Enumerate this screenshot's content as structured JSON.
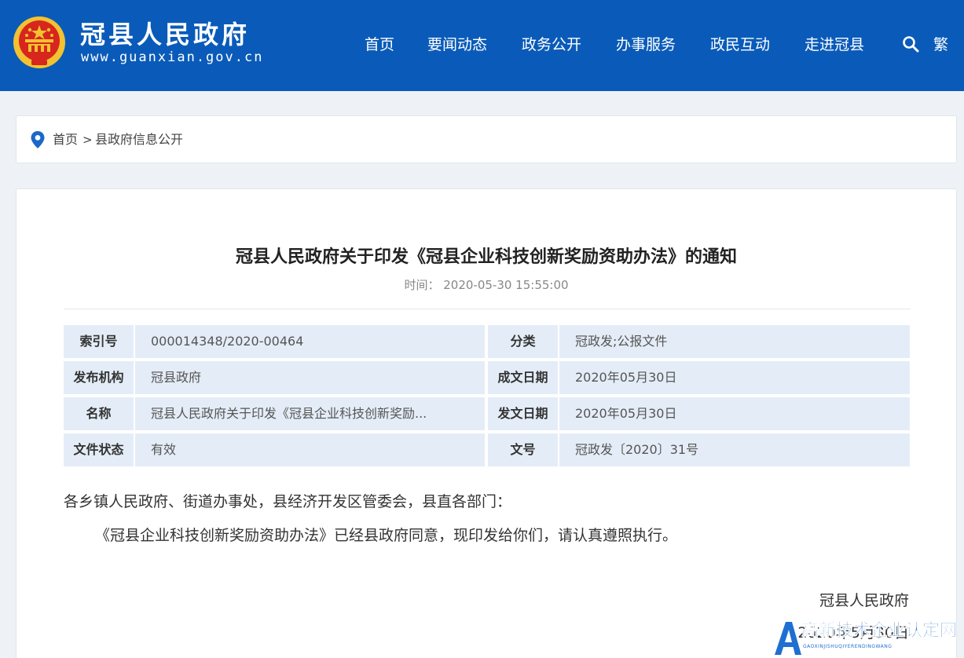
{
  "header": {
    "site_title": "冠县人民政府",
    "site_url": "www.guanxian.gov.cn",
    "nav": [
      "首页",
      "要闻动态",
      "政务公开",
      "办事服务",
      "政民互动",
      "走进冠县"
    ],
    "traditional_label": "繁",
    "search_icon": "search-icon",
    "brand_color": "#0a5bb9"
  },
  "breadcrumb": {
    "items": [
      "首页",
      "县政府信息公开"
    ],
    "separator": ">"
  },
  "article": {
    "title": "冠县人民政府关于印发《冠县企业科技创新奖励资助办法》的通知",
    "time_label": "时间：",
    "time_value": "2020-05-30 15:55:00",
    "info": [
      {
        "label": "索引号",
        "value": "000014348/2020-00464"
      },
      {
        "label": "分类",
        "value": "冠政发;公报文件"
      },
      {
        "label": "发布机构",
        "value": "冠县政府"
      },
      {
        "label": "成文日期",
        "value": "2020年05月30日"
      },
      {
        "label": "名称",
        "value": "冠县人民政府关于印发《冠县企业科技创新奖励..."
      },
      {
        "label": "发文日期",
        "value": "2020年05月30日"
      },
      {
        "label": "文件状态",
        "value": "有效"
      },
      {
        "label": "文号",
        "value": "冠政发〔2020〕31号"
      }
    ],
    "salutation": "各乡镇人民政府、街道办事处，县经济开发区管委会，县直各部门：",
    "body": "《冠县企业科技创新奖励资助办法》已经县政府同意，现印发给你们，请认真遵照执行。",
    "signature": "冠县人民政府",
    "date": "2020年5月30日"
  },
  "watermark": {
    "title": "高新技术企业认定网",
    "subtitle": "GAOXINJISHUQIYERENDINGWANG"
  }
}
